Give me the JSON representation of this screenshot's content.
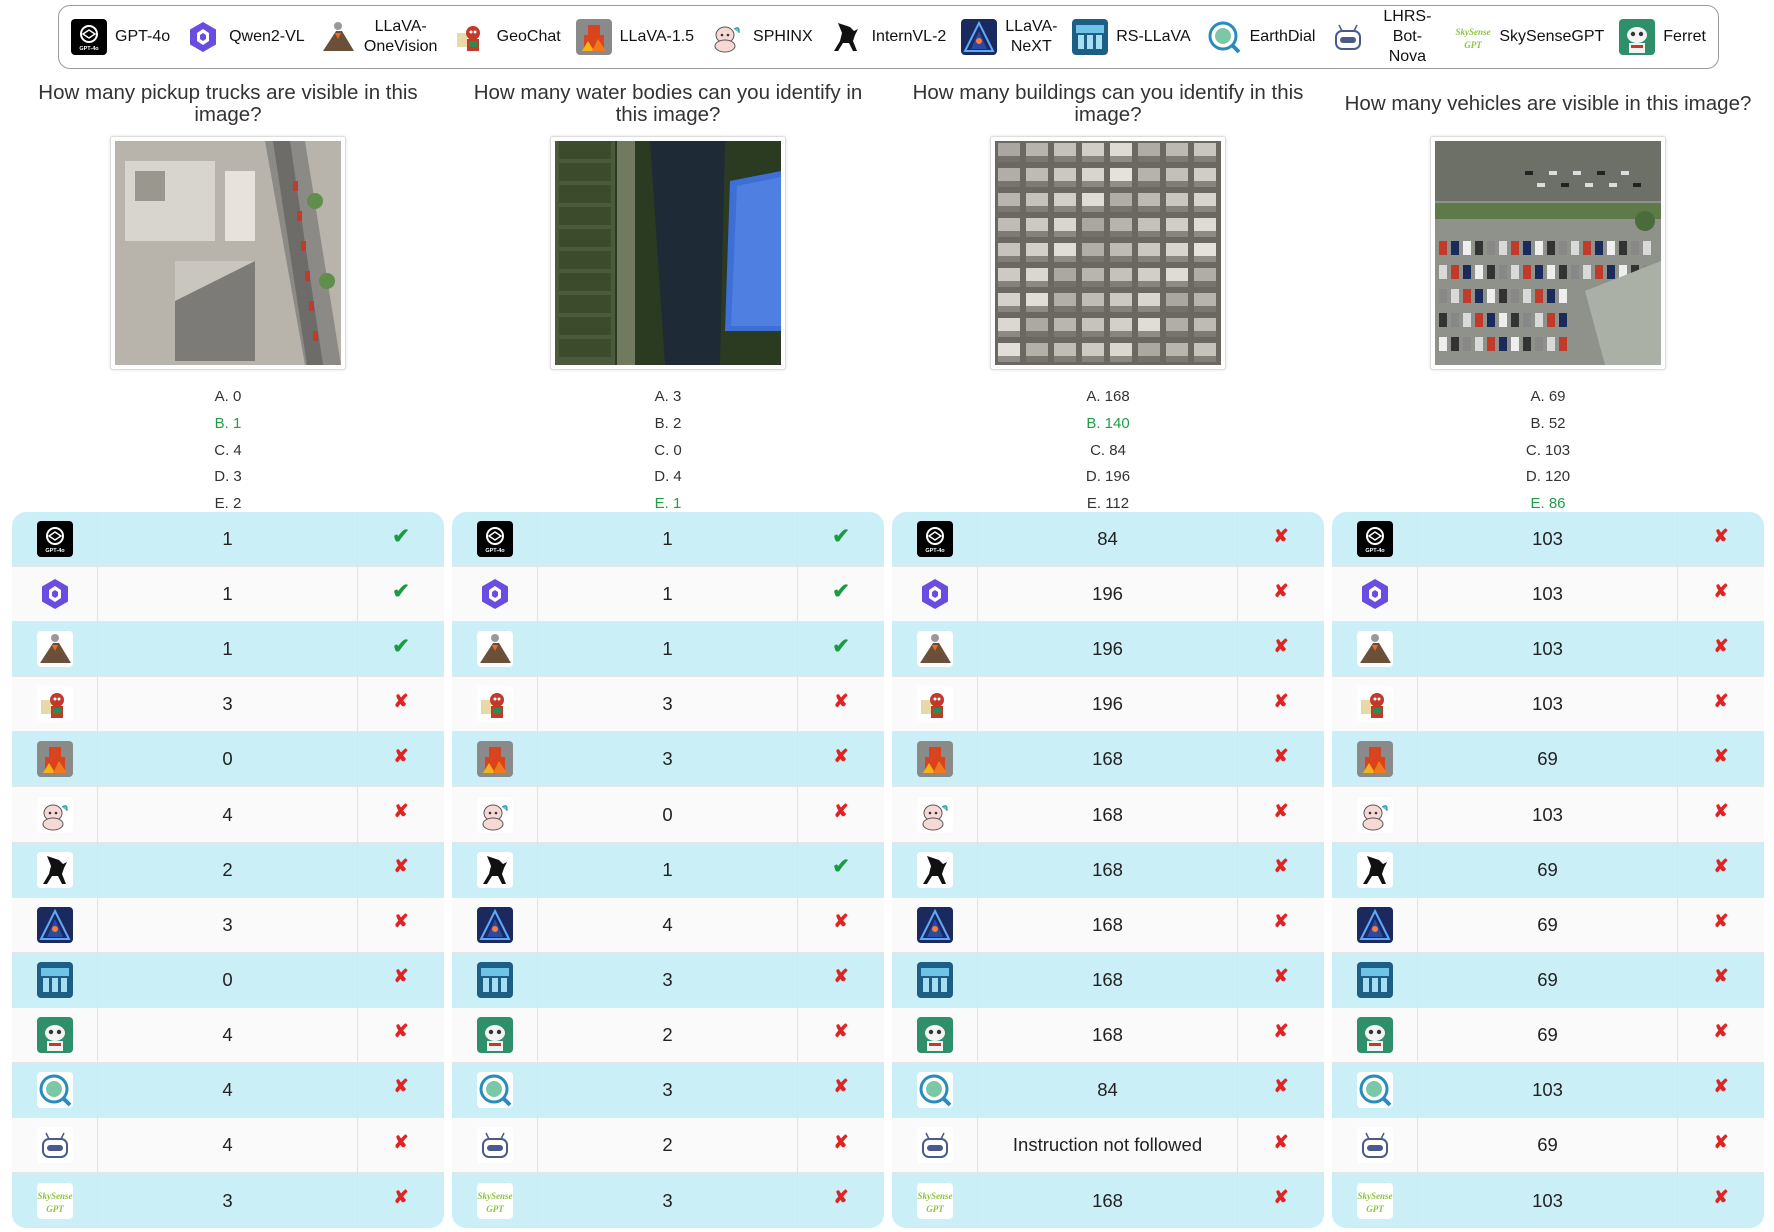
{
  "legend": [
    {
      "name": "GPT-4o",
      "icon": "gpt4o-icon",
      "color": "#111111"
    },
    {
      "name": "Qwen2-VL",
      "icon": "qwen-icon",
      "color": "#6a4ce0"
    },
    {
      "name": "LLaVA-OneVision",
      "icon": "volcano-icon",
      "color": "#7a5a3a"
    },
    {
      "name": "GeoChat",
      "icon": "geochat-icon",
      "color": "#c23a2a"
    },
    {
      "name": "LLaVA-1.5",
      "icon": "llava15-icon",
      "color": "#d9431e"
    },
    {
      "name": "SPHINX",
      "icon": "sphinx-icon",
      "color": "#e9a3a9"
    },
    {
      "name": "InternVL-2",
      "icon": "internvl-icon",
      "color": "#111111"
    },
    {
      "name": "LLaVA-NeXT",
      "icon": "llavanext-icon",
      "color": "#2b3f8a"
    },
    {
      "name": "RS-LLaVA",
      "icon": "rsllava-icon",
      "color": "#2c7ea6"
    },
    {
      "name": "EarthDial",
      "icon": "earthdial-icon",
      "color": "#2a8bbf"
    },
    {
      "name": "LHRS-Bot-Nova",
      "icon": "robot-icon",
      "color": "#4a5a8a"
    },
    {
      "name": "SkySenseGPT",
      "icon": "skysense-icon",
      "color": "#8cc63f"
    },
    {
      "name": "Ferret",
      "icon": "ferret-icon",
      "color": "#2f8f6b"
    }
  ],
  "questions": [
    {
      "text": "How many pickup trucks are visible in this image?",
      "options": [
        {
          "t": "A. 0",
          "ok": false
        },
        {
          "t": "B. 1",
          "ok": true
        },
        {
          "t": "C. 4",
          "ok": false
        },
        {
          "t": "D. 3",
          "ok": false
        },
        {
          "t": "E. 2",
          "ok": false
        }
      ],
      "answers": [
        "1",
        "1",
        "1",
        "3",
        "0",
        "4",
        "2",
        "3",
        "0",
        "4",
        "4",
        "4",
        "3"
      ],
      "correct": [
        true,
        true,
        true,
        false,
        false,
        false,
        false,
        false,
        false,
        false,
        false,
        false,
        false
      ]
    },
    {
      "text": "How many water bodies can you identify in this image?",
      "options": [
        {
          "t": "A. 3",
          "ok": false
        },
        {
          "t": "B. 2",
          "ok": false
        },
        {
          "t": "C. 0",
          "ok": false
        },
        {
          "t": "D. 4",
          "ok": false
        },
        {
          "t": "E. 1",
          "ok": true
        }
      ],
      "answers": [
        "1",
        "1",
        "1",
        "3",
        "3",
        "0",
        "1",
        "4",
        "3",
        "2",
        "3",
        "2",
        "3"
      ],
      "correct": [
        true,
        true,
        true,
        false,
        false,
        false,
        true,
        false,
        false,
        false,
        false,
        false,
        false
      ]
    },
    {
      "text": "How many buildings can you identify in this image?",
      "options": [
        {
          "t": "A. 168",
          "ok": false
        },
        {
          "t": "B. 140",
          "ok": true
        },
        {
          "t": "C. 84",
          "ok": false
        },
        {
          "t": "D. 196",
          "ok": false
        },
        {
          "t": "E. 112",
          "ok": false
        }
      ],
      "answers": [
        "84",
        "196",
        "196",
        "196",
        "168",
        "168",
        "168",
        "168",
        "168",
        "168",
        "84",
        "Instruction not followed",
        "168"
      ],
      "correct": [
        false,
        false,
        false,
        false,
        false,
        false,
        false,
        false,
        false,
        false,
        false,
        false,
        false
      ]
    },
    {
      "text": "How many vehicles are visible in this image?",
      "options": [
        {
          "t": "A. 69",
          "ok": false
        },
        {
          "t": "B. 52",
          "ok": false
        },
        {
          "t": "C. 103",
          "ok": false
        },
        {
          "t": "D. 120",
          "ok": false
        },
        {
          "t": "E. 86",
          "ok": true
        }
      ],
      "answers": [
        "103",
        "103",
        "103",
        "103",
        "69",
        "103",
        "69",
        "69",
        "69",
        "69",
        "103",
        "69",
        "103"
      ],
      "correct": [
        false,
        false,
        false,
        false,
        false,
        false,
        false,
        false,
        false,
        false,
        false,
        false,
        false
      ]
    }
  ],
  "row_models": [
    "GPT-4o",
    "Qwen2-VL",
    "LLaVA-OneVision",
    "GeoChat",
    "LLaVA-1.5",
    "SPHINX",
    "InternVL-2",
    "LLaVA-NeXT",
    "RS-LLaVA",
    "Ferret",
    "EarthDial",
    "LHRS-Bot-Nova",
    "SkySenseGPT"
  ],
  "marks": {
    "correct": "✔",
    "wrong": "✘"
  },
  "colors": {
    "correct_option": "#1f9e46",
    "row_highlight": "#cbeff7",
    "check": "#1b9b43",
    "cross": "#e02424"
  }
}
